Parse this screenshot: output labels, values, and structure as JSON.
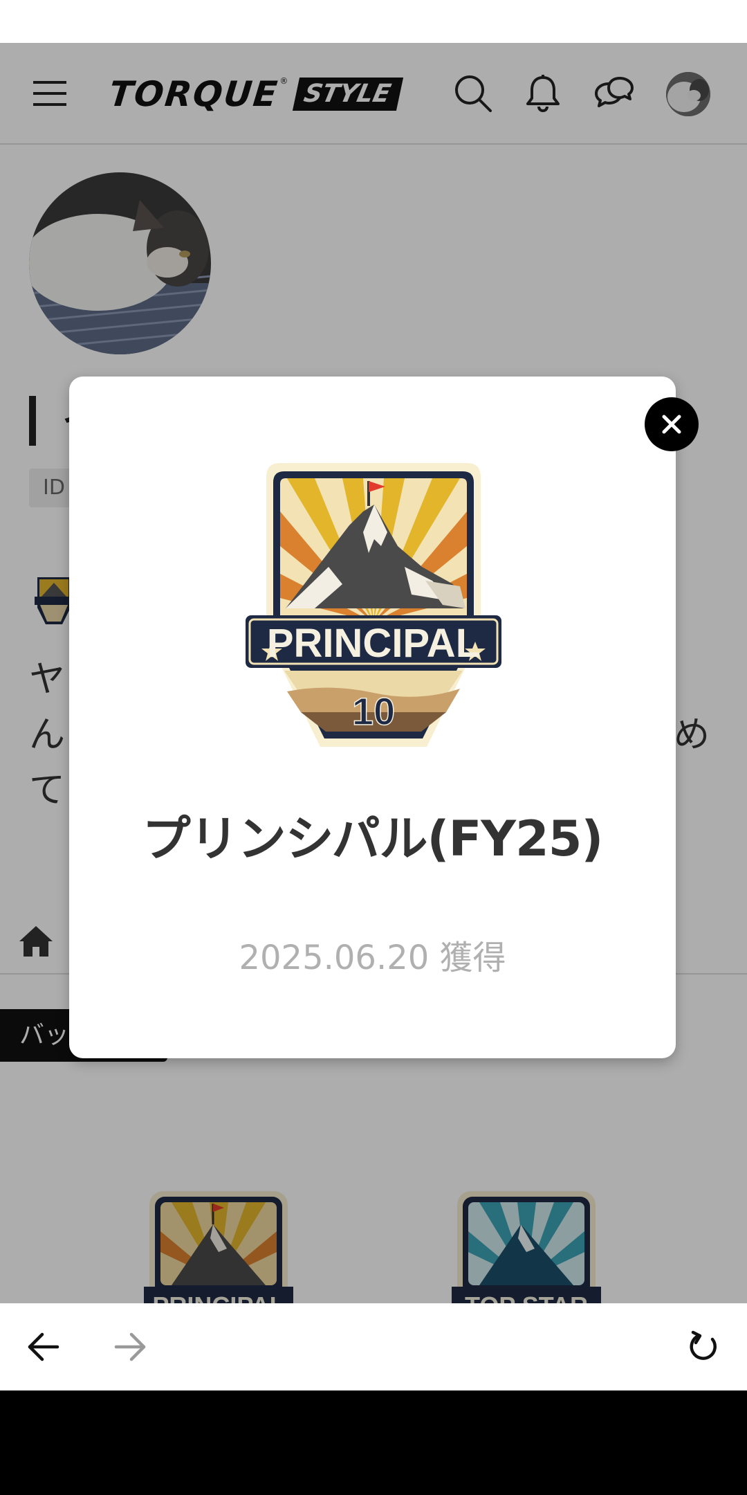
{
  "header": {
    "logo_main": "TORQUE",
    "logo_reg": "®",
    "logo_tag": "STYLE"
  },
  "profile": {
    "name": "イ",
    "id_label": "ID",
    "bio": "ヤ\nん　　　　　　　　　　　　　　　　　め\nて"
  },
  "section": {
    "label": "バッ"
  },
  "badges": [
    {
      "banner": "PRINCIPAL",
      "level": "10",
      "theme": "sunset"
    },
    {
      "banner": "TOP STAR",
      "theme": "teal"
    }
  ],
  "modal": {
    "badge_banner": "PRINCIPAL",
    "badge_level": "10",
    "title": "プリンシパル(FY25)",
    "date": "2025.06.20 獲得"
  },
  "colors": {
    "overlay": "rgba(0,0,0,0.32)",
    "badge_navy": "#1e2a44",
    "badge_gold": "#e3b52b",
    "badge_orange": "#d9812e",
    "badge_teal": "#3ba3b5",
    "date_gray": "#b0b0b0"
  },
  "icons": [
    "menu-icon",
    "search-icon",
    "bell-icon",
    "chat-icon",
    "home-icon",
    "close-icon",
    "back-arrow-icon",
    "forward-arrow-icon",
    "reload-icon"
  ]
}
